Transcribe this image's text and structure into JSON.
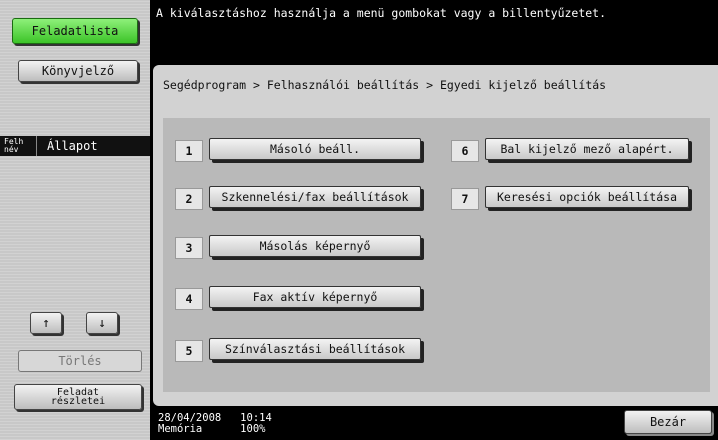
{
  "sidebar": {
    "job_list_label": "Feladatlista",
    "bookmark_label": "Könyvjelző",
    "header_user": "Felh név",
    "header_status": "Állapot",
    "up_arrow": "↑",
    "down_arrow": "↓",
    "delete_label": "Törlés",
    "job_details_label": "Feladat részletei"
  },
  "top_message": "A kiválasztáshoz használja a menü gombokat vagy a billentyűzetet.",
  "breadcrumb": "Segédprogram > Felhasználói beállítás > Egyedi kijelző beállítás",
  "menu": [
    {
      "num": "1",
      "label": "Másoló beáll."
    },
    {
      "num": "2",
      "label": "Szkennelési/fax beállítások"
    },
    {
      "num": "3",
      "label": "Másolás képernyő"
    },
    {
      "num": "4",
      "label": "Fax aktív képernyő"
    },
    {
      "num": "5",
      "label": "Színválasztási beállítások"
    },
    {
      "num": "6",
      "label": "Bal kijelző mező alapért."
    },
    {
      "num": "7",
      "label": "Keresési opciók beállítása"
    }
  ],
  "footer": {
    "datetime": "28/04/2008   10:14",
    "memory": "Memória      100%",
    "close_label": "Bezár"
  }
}
